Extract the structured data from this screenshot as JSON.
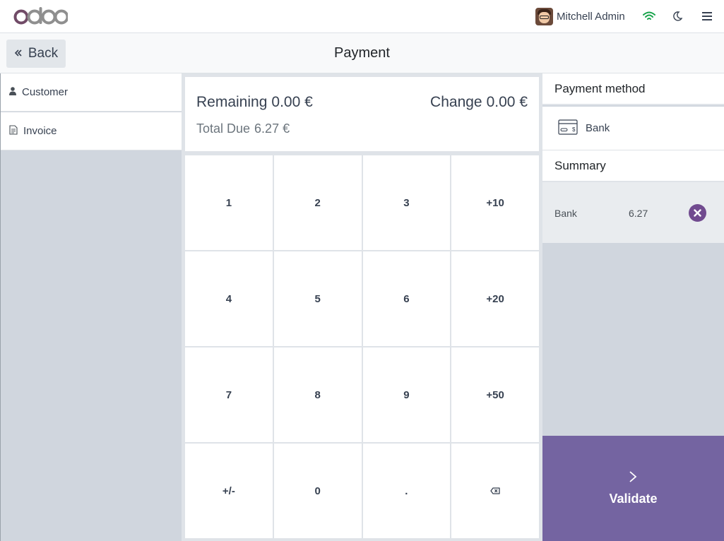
{
  "topbar": {
    "logo_text": "odoo",
    "user_name": "Mitchell Admin",
    "icons": [
      "avatar",
      "wifi-icon",
      "moon-icon",
      "hamburger-menu-icon"
    ],
    "wifi_color": "#16a34a"
  },
  "header": {
    "back_label": "Back",
    "title": "Payment"
  },
  "left": {
    "customer_label": "Customer",
    "invoice_label": "Invoice"
  },
  "totals": {
    "remaining_label": "Remaining",
    "remaining_value": "0.00 €",
    "change_label": "Change",
    "change_value": "0.00 €",
    "total_due_label": "Total Due",
    "total_due_value": "6.27 €"
  },
  "numpad": {
    "keys": [
      "1",
      "2",
      "3",
      "+10",
      "4",
      "5",
      "6",
      "+20",
      "7",
      "8",
      "9",
      "+50",
      "+/-",
      "0",
      ".",
      "backspace-icon"
    ]
  },
  "right": {
    "payment_method_title": "Payment method",
    "method_name": "Bank",
    "summary_title": "Summary",
    "line_name": "Bank",
    "line_amount": "6.27",
    "validate_label": "Validate",
    "accent_color": "#7464a1"
  }
}
